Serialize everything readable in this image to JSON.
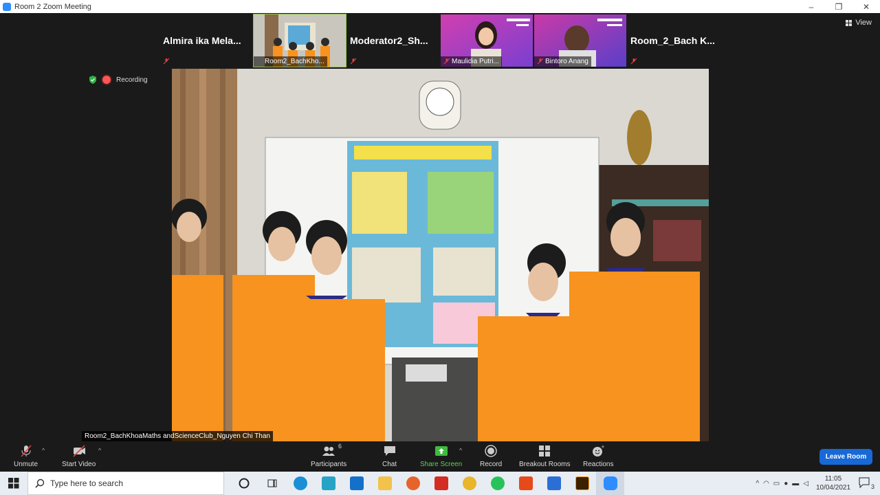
{
  "window": {
    "title": "Room 2   Zoom Meeting",
    "minimize": "–",
    "restore": "❐",
    "close": "✕"
  },
  "view_label": "View",
  "recording_label": "Recording",
  "participants_strip": [
    {
      "name": "Almira ika Mela...",
      "type": "name-only"
    },
    {
      "label": "Room2_BachKho...",
      "type": "video",
      "selected": true
    },
    {
      "name": "Moderator2_Sh...",
      "type": "name-only"
    },
    {
      "label": "Maulidia Putri...",
      "type": "video"
    },
    {
      "label": "Bintoro Anang",
      "type": "video"
    },
    {
      "name": "Room_2_Bach K...",
      "type": "name-only"
    }
  ],
  "main_speaker_name": "Room2_BachKhoaMaths andScienceClub_Nguyen Chi Than",
  "toolbar": {
    "unmute": "Unmute",
    "start_video": "Start Video",
    "participants": "Participants",
    "participants_count": "6",
    "chat": "Chat",
    "share_screen": "Share Screen",
    "record": "Record",
    "breakout_rooms": "Breakout Rooms",
    "reactions": "Reactions",
    "leave": "Leave Room"
  },
  "taskbar": {
    "search_placeholder": "Type here to search",
    "time": "11:05",
    "date": "10/04/2021",
    "notification_count": "3"
  },
  "colors": {
    "accent": "#2d8cff",
    "leave": "#1769d7",
    "share_green": "#5bd25b",
    "shirt_orange": "#f7931e"
  }
}
